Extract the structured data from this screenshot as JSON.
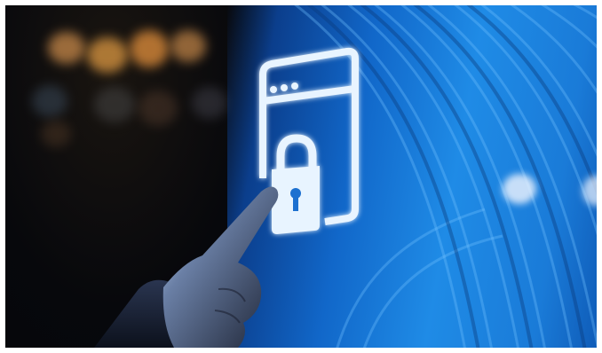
{
  "scene": {
    "description_icon": "browser-lock-icon",
    "colors": {
      "screen_blue": "#1a7bd8",
      "screen_dark": "#0b3e8c",
      "icon_glow": "#e8f4ff",
      "bokeh_warm": "#d98a3a",
      "background_dark": "#05070d"
    }
  }
}
